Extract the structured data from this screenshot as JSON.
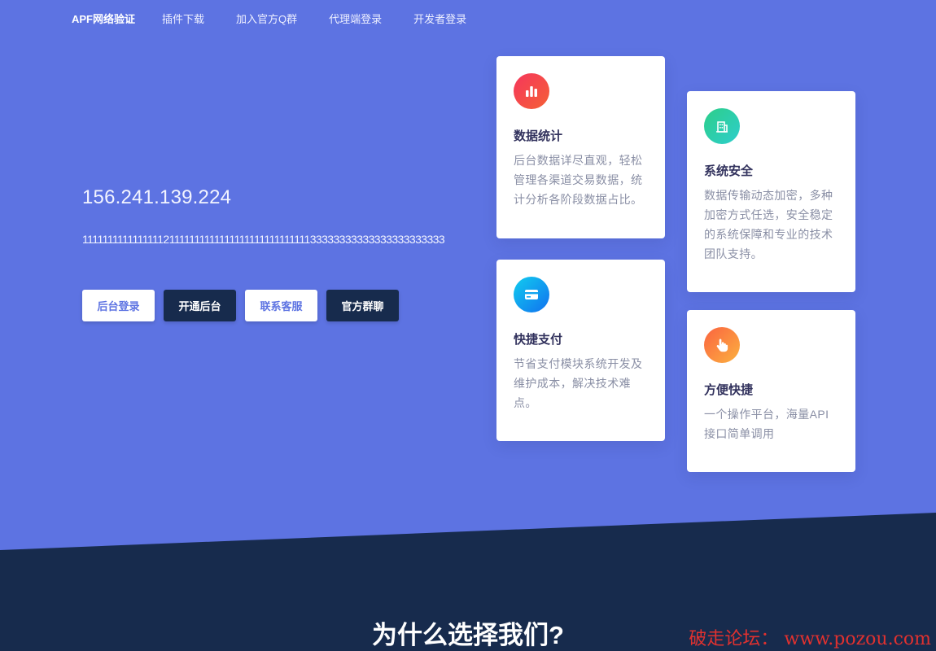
{
  "nav": {
    "brand": "APF网络验证",
    "links": [
      "插件下载",
      "加入官方Q群",
      "代理端登录",
      "开发者登录"
    ]
  },
  "hero": {
    "ip": "156.241.139.224",
    "description": "11111111111111112111111111111111111111111111133333333333333333333333",
    "buttons": [
      "后台登录",
      "开通后台",
      "联系客服",
      "官方群聊"
    ]
  },
  "cards": [
    {
      "icon": "bar-chart-icon",
      "title": "数据统计",
      "text": "后台数据详尽直观，轻松管理各渠道交易数据，统计分析各阶段数据占比。"
    },
    {
      "icon": "building-icon",
      "title": "系统安全",
      "text": "数据传输动态加密，多种加密方式任选，安全稳定的系统保障和专业的技术团队支持。"
    },
    {
      "icon": "credit-card-icon",
      "title": "快捷支付",
      "text": "节省支付模块系统开发及维护成本，解决技术难点。"
    },
    {
      "icon": "hand-pointer-icon",
      "title": "方便快捷",
      "text": "一个操作平台，海量API接口简单调用"
    }
  ],
  "section": {
    "title": "为什么选择我们?"
  },
  "watermark": "破走论坛： www.pozou.com",
  "colors": {
    "hero_bg": "#5d73e2",
    "dark_bg": "#172b4d",
    "button_dark": "#172b4d",
    "accent_red": "#f5365c",
    "accent_green": "#2dce89",
    "accent_blue": "#11cdef",
    "accent_orange": "#fb6340"
  }
}
